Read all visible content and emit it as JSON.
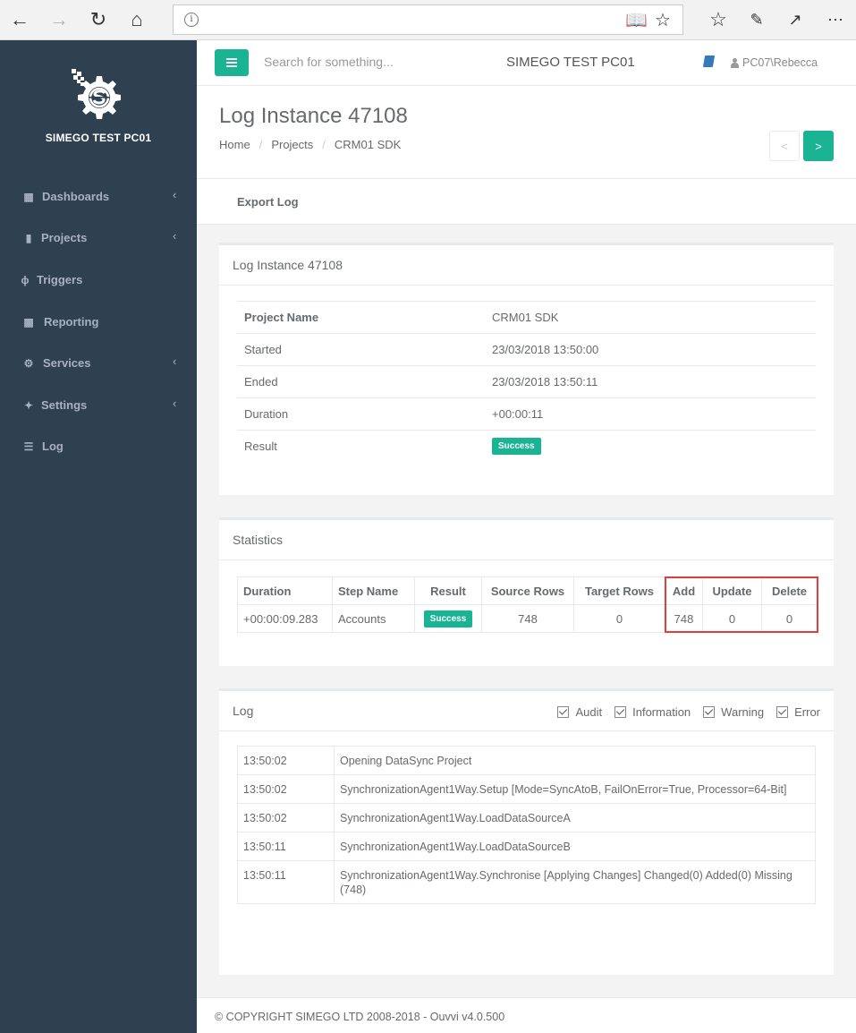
{
  "browser": {
    "back_icon": "back-arrow-icon",
    "forward_icon": "forward-arrow-icon",
    "refresh_icon": "refresh-icon",
    "home_icon": "home-icon",
    "address_value": "",
    "info_glyph": "i",
    "reading_view_icon": "reading-view-icon",
    "favorite_icon": "star-icon",
    "favorites_icon": "favorites-list-icon",
    "notes_icon": "pen-icon",
    "share_icon": "share-icon",
    "more_icon": "more-icon"
  },
  "sidebar": {
    "brand": "SIMEGO TEST PC01",
    "items": [
      {
        "label": "Dashboards",
        "icon": "grid-icon",
        "has_children": true
      },
      {
        "label": "Projects",
        "icon": "book-icon",
        "has_children": true
      },
      {
        "label": "Triggers",
        "icon": "bolt-icon",
        "has_children": false
      },
      {
        "label": "Reporting",
        "icon": "bar-chart-icon",
        "has_children": false
      },
      {
        "label": "Services",
        "icon": "gears-icon",
        "has_children": true
      },
      {
        "label": "Settings",
        "icon": "magic-wand-icon",
        "has_children": true
      },
      {
        "label": "Log",
        "icon": "list-icon",
        "has_children": false
      }
    ]
  },
  "topbar": {
    "search_placeholder": "Search for something...",
    "title": "SIMEGO TEST PC01",
    "user": "PC07\\Rebecca"
  },
  "heading": {
    "title": "Log Instance 47108",
    "breadcrumb": [
      "Home",
      "Projects",
      "CRM01 SDK"
    ],
    "breadcrumb_sep": "/",
    "prev_label": "<",
    "next_label": ">"
  },
  "toolbar": {
    "export_label": "Export Log"
  },
  "details": {
    "title": "Log Instance 47108",
    "rows": [
      {
        "label": "Project Name",
        "value": "CRM01 SDK"
      },
      {
        "label": "Started",
        "value": "23/03/2018 13:50:00"
      },
      {
        "label": "Ended",
        "value": "23/03/2018 13:50:11"
      },
      {
        "label": "Duration",
        "value": "+00:00:11"
      },
      {
        "label": "Result",
        "value": "Success"
      }
    ]
  },
  "statistics": {
    "title": "Statistics",
    "headers": [
      "Duration",
      "Step Name",
      "Result",
      "Source Rows",
      "Target Rows",
      "Add",
      "Update",
      "Delete"
    ],
    "rows": [
      {
        "duration": "+00:00:09.283",
        "step": "Accounts",
        "result": "Success",
        "source": "748",
        "target": "0",
        "add": "748",
        "update": "0",
        "delete": "0"
      }
    ]
  },
  "log": {
    "title": "Log",
    "filters": [
      {
        "label": "Audit",
        "checked": true
      },
      {
        "label": "Information",
        "checked": true
      },
      {
        "label": "Warning",
        "checked": true
      },
      {
        "label": "Error",
        "checked": true
      }
    ],
    "entries": [
      {
        "time": "13:50:02",
        "message": "Opening DataSync Project"
      },
      {
        "time": "13:50:02",
        "message": "SynchronizationAgent1Way.Setup [Mode=SyncAtoB, FailOnError=True, Processor=64-Bit]"
      },
      {
        "time": "13:50:02",
        "message": "SynchronizationAgent1Way.LoadDataSourceA"
      },
      {
        "time": "13:50:11",
        "message": "SynchronizationAgent1Way.LoadDataSourceB"
      },
      {
        "time": "13:50:11",
        "message": "SynchronizationAgent1Way.Synchronise [Applying Changes] Changed(0) Added(0) Missing (748)"
      }
    ]
  },
  "footer": {
    "text": "© COPYRIGHT SIMEGO LTD 2008-2018 - Ouvvi v4.0.500"
  },
  "colors": {
    "accent": "#1ab394",
    "sidebar": "#2f4050",
    "link": "#337ab7",
    "highlight": "#e23c3c"
  }
}
